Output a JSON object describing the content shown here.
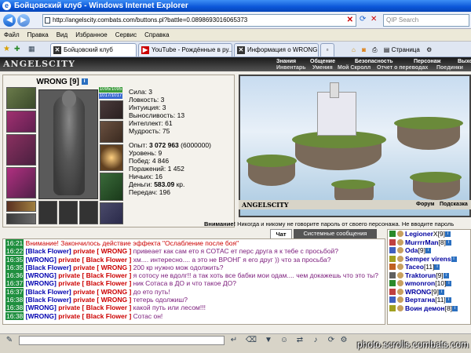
{
  "window": {
    "title": "Бойцовский клуб - Windows Internet Explorer"
  },
  "address": {
    "url": "http://angelscity.combats.com/buttons.pl?battle=0.0898693016065373",
    "search_placeholder": "QIP Search"
  },
  "menu": [
    "Файл",
    "Правка",
    "Вид",
    "Избранное",
    "Сервис",
    "Справка"
  ],
  "tabs": [
    {
      "label": "Бойцовский клуб",
      "icon": "close-x-icon"
    },
    {
      "label": "YouTube - Рождённые в ру...",
      "icon": "youtube-icon"
    },
    {
      "label": "Информация о WRONG",
      "icon": "close-x-icon"
    }
  ],
  "toolbar": {
    "page_label": "Страница"
  },
  "game": {
    "logo": "ANGELSCITY",
    "nav_top": [
      "Знания",
      "Общение",
      "Безопасность",
      "Персонаж",
      "Выход"
    ],
    "nav_bottom": [
      "Инвентарь",
      "Умения",
      "Мой Скролл",
      "Отчет о переводах",
      "Поединки"
    ],
    "character": {
      "name": "WRONG",
      "level": "[9]",
      "hp": "1095/1095",
      "mp": "1017/1017",
      "stats": [
        "Сила: 3",
        "Ловкость: 3",
        "Интуиция: 3",
        "Выносливость: 13",
        "Интеллект: 61",
        "Мудрость: 75"
      ],
      "exp_label": "Опыт:",
      "exp_value": "3 072 963",
      "exp_next": "(6000000)",
      "level_line": "Уровень: 9",
      "wins": "Побед: 4 846",
      "losses": "Поражений: 1 452",
      "draws": "Ничьих: 16",
      "money_label": "Деньги:",
      "money_value": "583.09",
      "money_unit": "кр.",
      "transfers": "Передач: 196"
    },
    "art_footer": {
      "logo": "ANGELSCITY",
      "forum": "Форум",
      "hint": "Подсказка"
    },
    "warning_bold": "Внимание!",
    "warning_text": "Никогда и никому не говорите пароль от своего персонажа. Не вводите пароль",
    "chat_tabs": [
      "Чат",
      "Системные сообщения"
    ],
    "chat": [
      {
        "time": "16:21",
        "name": "",
        "private": "",
        "text": "Внимание! Закончилось действие эффекта \"Ослабление после боя\""
      },
      {
        "time": "16:22",
        "name": "[Black Flower]",
        "private": "private [ WRONG ]",
        "text": "привеает как сам ето я СОТАС ет перс друга я к тебе с просьбой?"
      },
      {
        "time": "16:35",
        "name": "[WRONG]",
        "private": "private [ Black Flower ]",
        "text": "хм.... интересно.... а это не ВРОНГ я его друг )) что за просьба?"
      },
      {
        "time": "16:35",
        "name": "[Black Flower]",
        "private": "private [ WRONG ]",
        "text": "200 кр нужно мож одолжить?"
      },
      {
        "time": "16:36",
        "name": "[WRONG]",
        "private": "private [ Black Flower ]",
        "text": "я сотосу не вдолг!! а так хоть все бабки мои одам.... чем докажешь что это ты?"
      },
      {
        "time": "16:37",
        "name": "[WRONG]",
        "private": "private [ Black Flower ]",
        "text": "ник Сотаса в ДО и что такое ДО?"
      },
      {
        "time": "16:37",
        "name": "[Black Flower]",
        "private": "private [ WRONG ]",
        "text": "до ето путь!"
      },
      {
        "time": "16:38",
        "name": "[Black Flower]",
        "private": "private [ WRONG ]",
        "text": "тетерь одолжиш?"
      },
      {
        "time": "16:38",
        "name": "[WRONG]",
        "private": "private [ Black Flower ]",
        "text": "какой путь или лесом!!!"
      },
      {
        "time": "16:38",
        "name": "[WRONG]",
        "private": "private [ Black Flower ]",
        "text": "Сотас он!"
      }
    ],
    "users": [
      {
        "name": "Legioner",
        "level": "X[9]"
      },
      {
        "name": "MurrrrMan",
        "level": "[8]"
      },
      {
        "name": "Oda",
        "level": "[9]"
      },
      {
        "name": "Semper virens",
        "level": ""
      },
      {
        "name": "Taceo",
        "level": "[11]"
      },
      {
        "name": "Traktorun",
        "level": "[9]"
      },
      {
        "name": "wmonron",
        "level": "[10]"
      },
      {
        "name": "WRONG",
        "level": "[9]"
      },
      {
        "name": "Вертагна",
        "level": "[11]"
      },
      {
        "name": "Воин демон",
        "level": "[8]"
      }
    ]
  },
  "watermark": "photo.scrolls.combats.com",
  "colors": {
    "chat_time_bg": "#1f8f3f",
    "name": "#0000b0",
    "private": "#cc0000",
    "hp": "#3a9a3a",
    "mp": "#3a6ad0"
  }
}
